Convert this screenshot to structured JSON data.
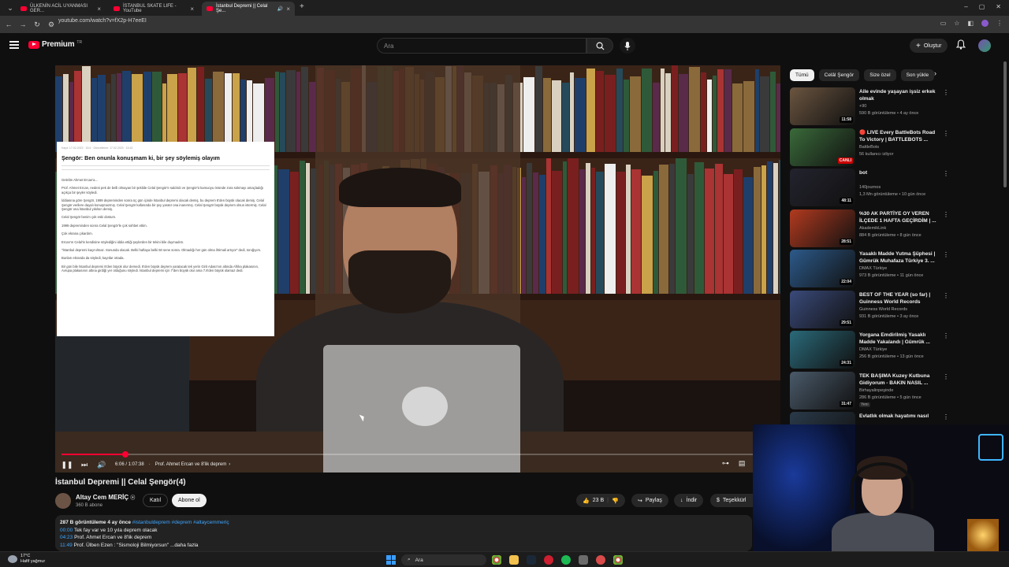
{
  "browser": {
    "tabs": [
      {
        "title": "ÜLKENİN ACİL UYANMASI GER..."
      },
      {
        "title": "İSTANBUL SKATE LIFE - YouTube"
      },
      {
        "title": "İstanbul Depremi || Celal Şe..."
      }
    ],
    "url": "youtube.com/watch?v=fX2p-H7eeEI"
  },
  "header": {
    "logo_text": "Premium",
    "logo_region": "TR",
    "search_placeholder": "Ara",
    "create_label": "Oluştur"
  },
  "video": {
    "article": {
      "meta": "Kayıt: 17.02.2023 · 15:4  ·  Güncelleme: 17.02.2023 · 15:42",
      "headline": "Şengör: Ben onunla konuşmam ki, bir şey söylemiş olayım",
      "paragraphs": [
        "Gelelim Ahmet Ercan'a...",
        "Prof. Ahmet Ercan, nedeni pek de belli olmayan bir şekilde Celal Şengör'e saldırdı ve Şengör'ü kamuoyu önünde zora sokmayı amaçladığı açıkça bir şeyler söyledi.",
        "İddiasına göre Şengör, 1999 depreminden sonra üç gün içinde İstanbul depremi olacak demiş, bu deprem 8'den büyük olacak demiş. Celal Şengör verilere dayalı konuşmazmış. Celal Şengör kafasında bir şey yaratır ona inanırmış. Celal Şengör büyük deprem olsun istermiş. Celal Şengör ona İstanbul yıkılsın demiş.",
        "Celal Şengör benim çok eski dostum.",
        "1999 depreminden sonra Celal Şengör'le çok sohbet ettim.",
        "Çok ekrana çıkardım.",
        "Ercan'ın Celal'in kendisine söylediğini iddia ettiği şeylerden bir tekini bile duymadım.",
        "\"İstanbul depremi kaçınılmaz. Sonunda olacak. Belki haftaya belki 50 sene sonra. Olmadığı her gün olma ihtimali artıyor\" dedi, tonığıyım.",
        "Bunları ekranda da söyledi, kayıtlar ortada.",
        "Bir gün bile İstanbul depremi 8'den büyük olur demedi. 8'den büyük deprem yaratacak tek yerin Girit Adası'nın altında Afrika plakasının, Avrupa plakasının altına girdiği yer olduğunu söyledi. İstanbul depremi için 7'den büyük olur ama 7.8'den büyük olamaz dedi."
      ]
    },
    "progress": 0.09,
    "time": "6:06 / 1:07:38",
    "chapter": "Prof. Ahmet Ercan ve 8'lik deprem"
  },
  "meta": {
    "title": "İstanbul Depremi || Celal Şengör(4)",
    "channel": "Altay Cem MERİÇ",
    "subscribers": "360 B abone",
    "join_label": "Katıl",
    "subscribe_label": "Abone ol",
    "likes": "23 B",
    "share_label": "Paylaş",
    "download_label": "İndir",
    "thanks_label": "Teşekkürl"
  },
  "description": {
    "stats": "287 B görüntüleme  4 ay önce",
    "tags": "#istanbuldeprem #deprem #altaycemmeriç",
    "chapters": [
      {
        "ts": "00:00",
        "text": "Tek fay var ve 10 yıla deprem olacak"
      },
      {
        "ts": "04:23",
        "text": "Prof. Ahmet Ercan ve 8'lik deprem"
      },
      {
        "ts": "11:49",
        "text": "Prof. Ülben Ezen : \"Sismoloji Bilmiyorsun\"   ...daha fazla"
      }
    ]
  },
  "chips": [
    "Tümü",
    "Celâl Şengör",
    "Size özel",
    "Son yükle"
  ],
  "recommendations": [
    {
      "title": "Aile evinde yaşayan işsiz erkek olmak",
      "channel": "+90",
      "meta": "590 B görüntüleme • 4 ay önce",
      "duration": "11:58",
      "color": "#6b5540"
    },
    {
      "title": "🔴 LIVE Every BattleBots Road To Victory | BATTLEBOTS ...",
      "channel": "BattleBots",
      "meta": "56 kullanıcı izliyor",
      "duration": "CANLI",
      "live": true,
      "color": "#3a6a3a"
    },
    {
      "title": "bot",
      "channel": "140journos",
      "meta": "1,3 Mn görüntüleme • 10 gün önce",
      "duration": "48:11",
      "color": "#23232e"
    },
    {
      "title": "%30 AK PARTİYE OY VEREN İLÇEDE 1 HAFTA GEÇİRDİM | ...",
      "channel": "AkademikLink",
      "meta": "884 B görüntüleme • 8 gün önce",
      "duration": "28:51",
      "color": "#b23a1f"
    },
    {
      "title": "Yasaklı Madde Yutma Şüphesi | Gümrük Muhafaza Türkiye 3. ...",
      "channel": "DMAX Türkiye",
      "meta": "973 B görüntüleme • 11 gün önce",
      "duration": "22:04",
      "color": "#2c5a8a"
    },
    {
      "title": "BEST OF THE YEAR (so far) | Guinness World Records",
      "channel": "Guinness World Records",
      "meta": "931 B görüntüleme • 3 ay önce",
      "duration": "29:51",
      "color": "#3a4a7a"
    },
    {
      "title": "Yorgana Emdirilmiş Yasaklı Madde Yakalandı | Gümrük ...",
      "channel": "DMAX Türkiye",
      "meta": "256 B görüntüleme • 13 gün önce",
      "duration": "24:31",
      "color": "#2a6a7a"
    },
    {
      "title": "TEK BAŞIMA Kuzey Kutbuna Gidiyorum - BAKIN NASIL ...",
      "channel": "Birhayalinpeşinde",
      "meta": "286 B görüntüleme • 5 gün önce",
      "duration": "31:47",
      "new": "Yeni",
      "color": "#4a5a6a"
    },
    {
      "title": "Evlatlık olmak hayatımı nasıl",
      "channel": "",
      "meta": "",
      "duration": "",
      "color": "#2a3a4a"
    }
  ],
  "taskbar": {
    "temp": "17°C",
    "weather": "Hafif yağmur",
    "search_placeholder": "Ara"
  },
  "colors": {
    "accent": "#ff0033",
    "link": "#3ea6ff",
    "bg": "#0f0f0f"
  }
}
